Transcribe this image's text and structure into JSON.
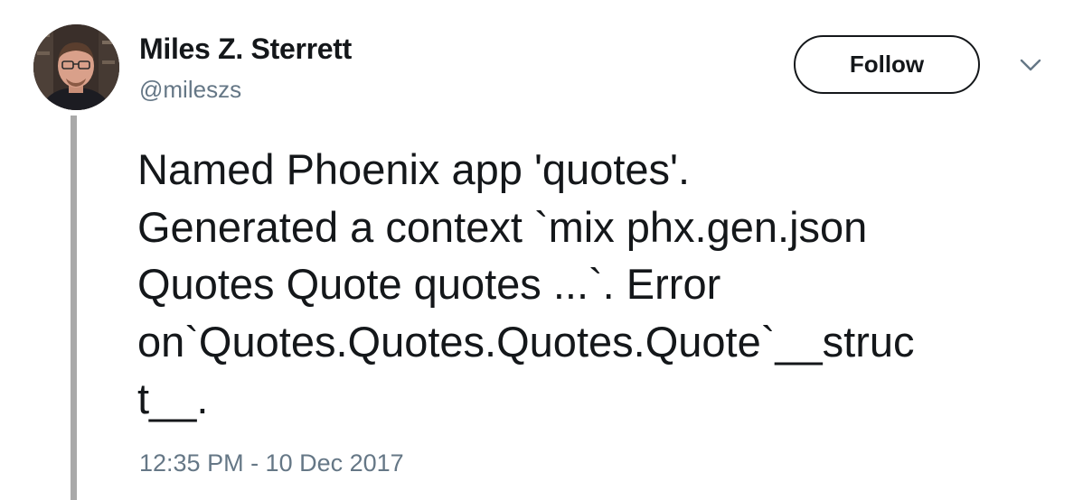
{
  "author": {
    "display_name": "Miles Z. Sterrett",
    "username": "@mileszs",
    "avatar_icon": "user-avatar-photo"
  },
  "actions": {
    "follow_label": "Follow",
    "menu_icon": "chevron-down-icon"
  },
  "tweet": {
    "text_lines": [
      "Named Phoenix app 'quotes'.",
      "Generated a context `mix phx.gen.json",
      "Quotes Quote quotes ...`. Error",
      "on`Quotes.Quotes.Quotes.Quote`__struc",
      "t__."
    ],
    "timestamp": "12:35 PM - 10 Dec 2017"
  },
  "colors": {
    "text": "#14171a",
    "secondary": "#657786",
    "thread_line": "#a9a9a9"
  }
}
